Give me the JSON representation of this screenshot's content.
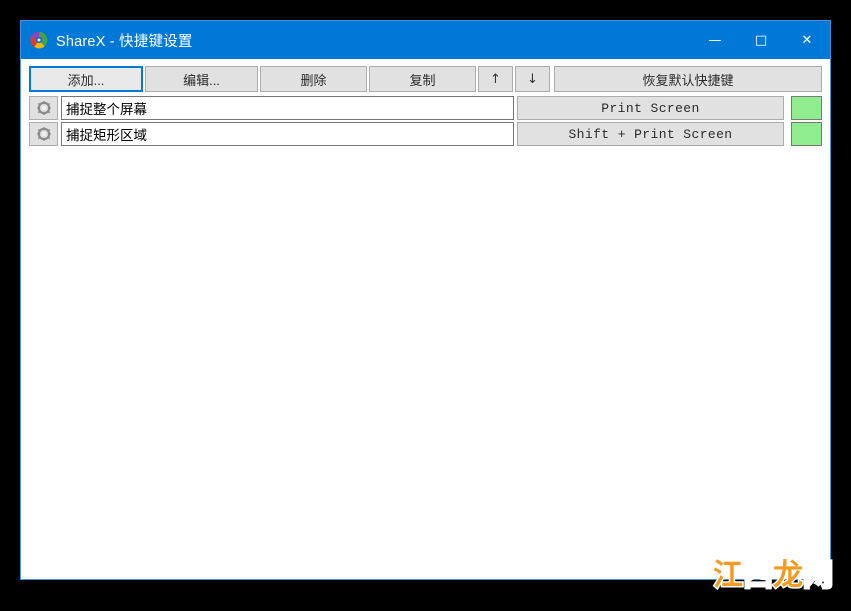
{
  "window": {
    "title": "ShareX - 快捷键设置",
    "logo_icon": "sharex-logo-icon",
    "controls": {
      "minimize": "—",
      "maximize": "□",
      "close": "✕",
      "minimize_name": "minimize-icon",
      "maximize_name": "maximize-icon",
      "close_name": "close-icon"
    }
  },
  "toolbar": {
    "add_label": "添加...",
    "edit_label": "编辑...",
    "delete_label": "删除",
    "copy_label": "复制",
    "move_up_label": "↑",
    "move_down_label": "↓",
    "reset_label": "恢复默认快捷键"
  },
  "hotkeys": {
    "rows": [
      {
        "settings_icon": "gear-icon",
        "task": "捕捉整个屏幕",
        "hotkey": "Print Screen",
        "status_color": "#90ee90"
      },
      {
        "settings_icon": "gear-icon",
        "task": "捕捉矩形区域",
        "hotkey": "Shift + Print Screen",
        "status_color": "#90ee90"
      }
    ]
  },
  "watermark": {
    "char1": "江",
    "char2": "西",
    "char3": "龙",
    "char4": "网"
  },
  "colors": {
    "titlebar": "#0078d7",
    "accent": "#0078d7",
    "status_ok": "#90ee90",
    "button_face": "#e1e1e1",
    "desktop": "#000000"
  }
}
